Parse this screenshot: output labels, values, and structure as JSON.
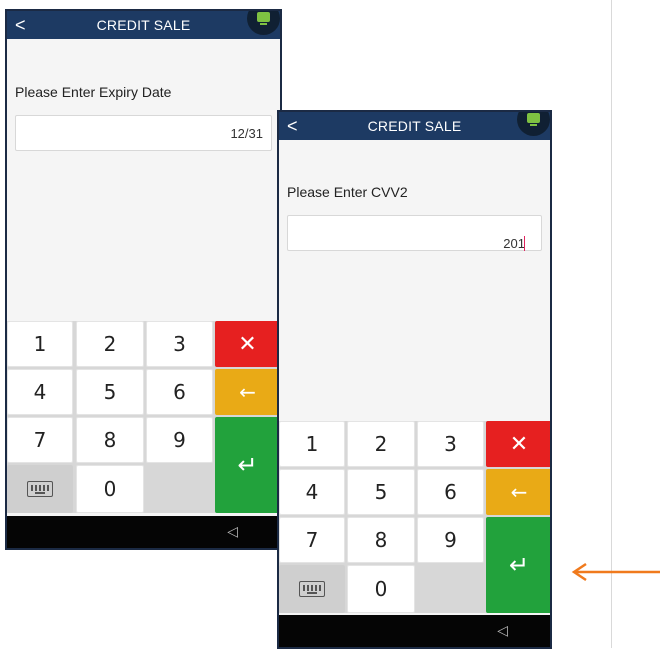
{
  "screens": [
    {
      "header": {
        "back_glyph": "<",
        "title": "CREDIT SALE"
      },
      "prompt": "Please Enter Expiry Date",
      "field_value": "12/31",
      "keys": [
        "1",
        "2",
        "3",
        "4",
        "5",
        "6",
        "7",
        "8",
        "9",
        "0"
      ]
    },
    {
      "header": {
        "back_glyph": "<",
        "title": "CREDIT SALE"
      },
      "prompt": "Please Enter CVV2",
      "field_value": "201",
      "keys": [
        "1",
        "2",
        "3",
        "4",
        "5",
        "6",
        "7",
        "8",
        "9",
        "0"
      ]
    }
  ],
  "keypad_symbols": {
    "cancel": "✕",
    "backspace": "←",
    "enter": "↵",
    "keyboard_icon": "keyboard-icon"
  },
  "nav": {
    "back_glyph": "◁"
  },
  "colors": {
    "header": "#1d3a63",
    "cancel_key": "#e62020",
    "backspace_key": "#e9aa16",
    "enter_key": "#22a23c",
    "annotation_arrow": "#f07a1d",
    "status_indicator": "#7ec142"
  }
}
